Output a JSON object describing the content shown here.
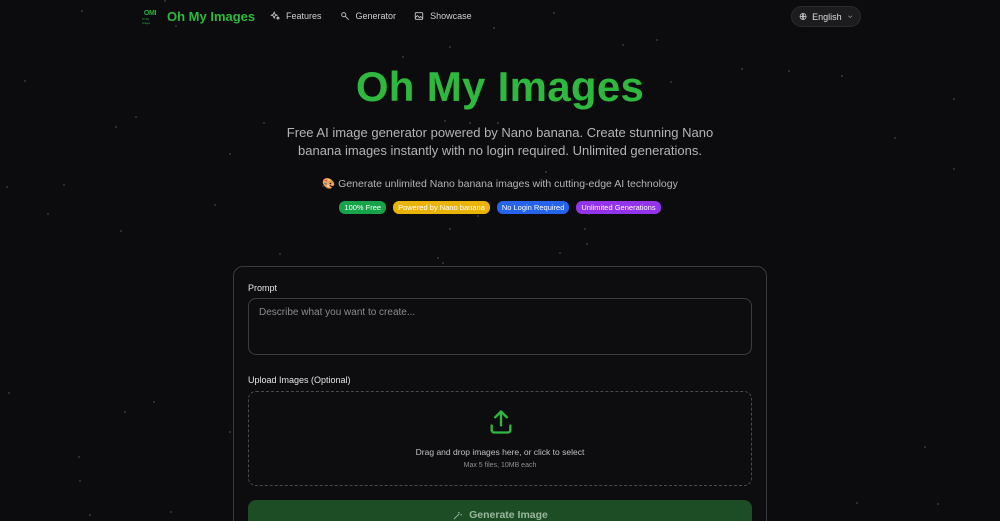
{
  "app": {
    "logo_mark": "OMI",
    "logo_subtext": "Oh My Images",
    "name": "Oh My Images"
  },
  "nav": {
    "items": [
      {
        "label": "Features",
        "icon": "sparkles-icon"
      },
      {
        "label": "Generator",
        "icon": "magic-wand-icon"
      },
      {
        "label": "Showcase",
        "icon": "image-icon"
      }
    ],
    "language": "English"
  },
  "hero": {
    "title": "Oh My Images",
    "subtitle": "Free AI image generator powered by Nano banana. Create stunning Nano banana images instantly with no login required. Unlimited generations.",
    "feature_emoji": "🎨",
    "feature_text": "Generate unlimited Nano banana images with cutting-edge AI technology",
    "badges": [
      {
        "label": "100% Free",
        "color": "#16a34a"
      },
      {
        "label": "Powered by Nano banana",
        "color": "#eab308"
      },
      {
        "label": "No Login Required",
        "color": "#2563eb"
      },
      {
        "label": "Unlimited Generations",
        "color": "#9333ea"
      }
    ]
  },
  "form": {
    "prompt_label": "Prompt",
    "prompt_placeholder": "Describe what you want to create...",
    "prompt_value": "",
    "upload_label": "Upload Images (Optional)",
    "upload_text": "Drag and drop images here, or click to select",
    "upload_hint": "Max 5 files, 10MB each",
    "generate_label": "Generate Image"
  },
  "colors": {
    "accent": "#2fb83e",
    "background": "#0c0c0e",
    "button": "#1d4d24"
  }
}
